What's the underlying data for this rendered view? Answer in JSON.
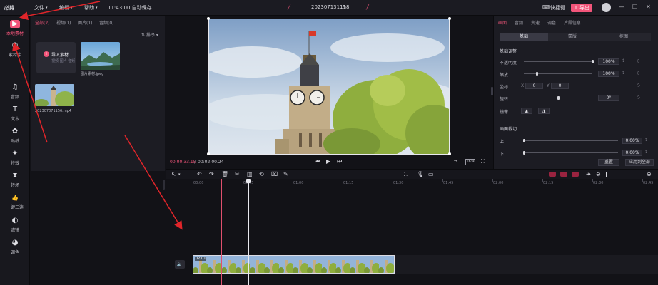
{
  "titlebar": {
    "logo": "必剪",
    "menu_file": "文件",
    "menu_edit": "编辑",
    "menu_help": "帮助",
    "autosave": "11:43:00 自动保存",
    "project_name": "202307131118",
    "shortcut": "快捷键",
    "export": "导出"
  },
  "rail": [
    {
      "icon": "film-icon",
      "glyph": "▶",
      "label": "本地素材"
    },
    {
      "icon": "material-icon",
      "glyph": "◉",
      "label": "素材库"
    },
    {
      "icon": "audio-icon",
      "glyph": "♫",
      "label": "音频"
    },
    {
      "icon": "text-icon",
      "glyph": "T",
      "label": "文本"
    },
    {
      "icon": "sticker-icon",
      "glyph": "✿",
      "label": "贴纸"
    },
    {
      "icon": "effect-icon",
      "glyph": "✦",
      "label": "特效"
    },
    {
      "icon": "transition-icon",
      "glyph": "⧗",
      "label": "转场"
    },
    {
      "icon": "like-icon",
      "glyph": "👍",
      "label": "一键三连"
    },
    {
      "icon": "filter-icon",
      "glyph": "◐",
      "label": "滤镜"
    },
    {
      "icon": "color-icon",
      "glyph": "◕",
      "label": "调色"
    }
  ],
  "media": {
    "tabs": [
      "全部(2)",
      "视频(1)",
      "图片(1)",
      "音频(0)"
    ],
    "sort": "排序",
    "import_title": "导入素材",
    "import_sub": "视频 图片 音频",
    "items": [
      {
        "name": "图片素材.jpeg"
      },
      {
        "name": "202307071156.mp4"
      }
    ]
  },
  "preview": {
    "current_time": "00:00:33.15",
    "total_time": "00:02:00.24",
    "ratio": "16:9"
  },
  "props": {
    "tabs": [
      "画面",
      "音频",
      "变速",
      "调色",
      "片段信息"
    ],
    "segments": [
      "基础",
      "蒙版",
      "抠图"
    ],
    "basic_title": "基础调整",
    "opacity_label": "不透明度",
    "opacity_value": "100%",
    "scale_label": "缩放",
    "scale_value": "100%",
    "coord_label": "坐标",
    "coord_x": "0",
    "coord_y": "0",
    "rotate_label": "旋转",
    "rotate_value": "0°",
    "mirror_label": "镜像",
    "crop_title": "画面裁切",
    "crop_top_label": "上",
    "crop_top_value": "0.00%",
    "crop_bottom_label": "下",
    "crop_bottom_value": "0.00%",
    "reset": "重置",
    "apply_all": "应用到全部"
  },
  "timeline": {
    "ticks": [
      "00:00",
      "00:15",
      "01:00",
      "01:15",
      "01:30",
      "01:45",
      "02:00",
      "02:15",
      "02:30",
      "02:45",
      "03:00"
    ],
    "clip_label": "02:01"
  },
  "colors": {
    "accent": "#f2557a",
    "panel": "#1c1c23",
    "bg": "#121217",
    "annotation_arrow": "#e0252a"
  }
}
